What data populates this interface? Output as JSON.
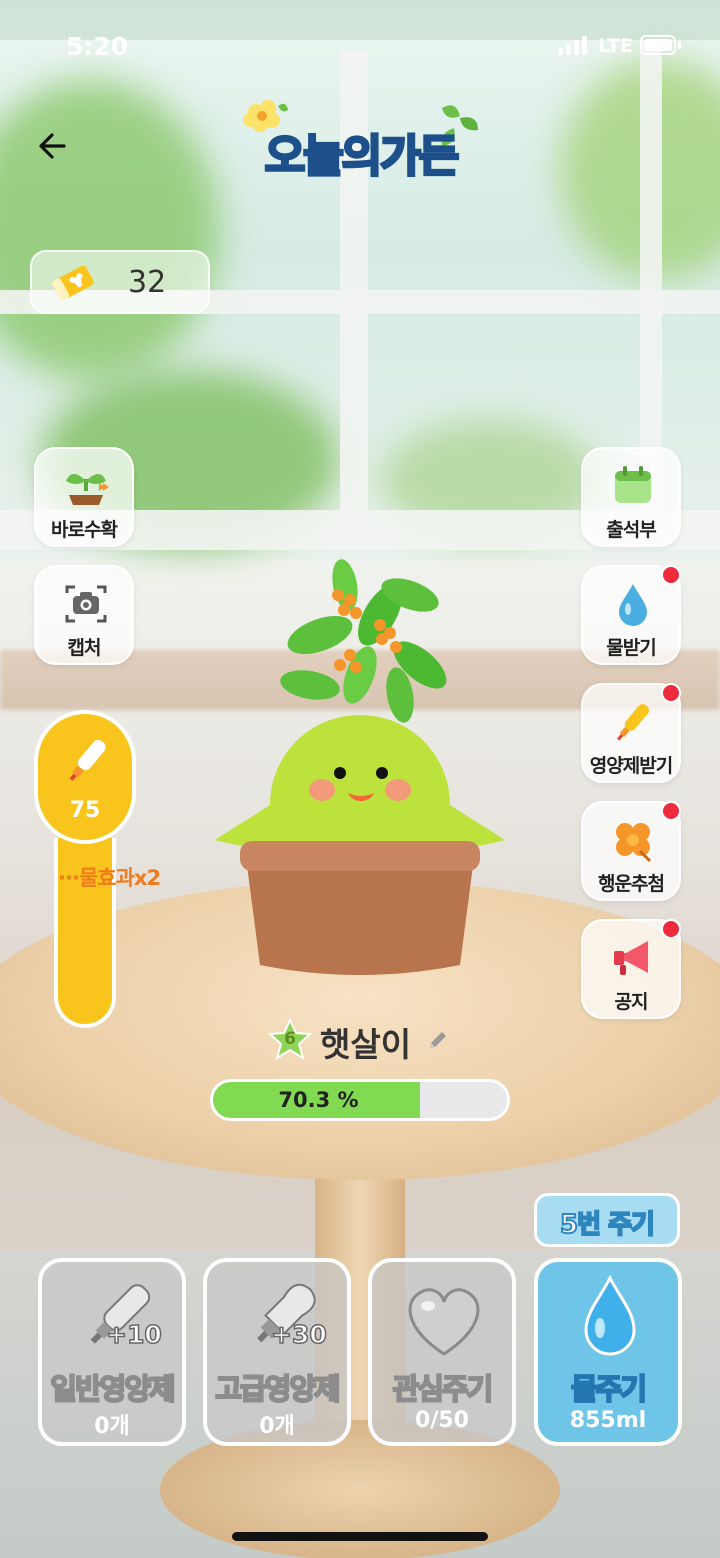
{
  "status_bar": {
    "time": "5:20",
    "network": "LTE"
  },
  "header": {
    "title": "오늘의가든"
  },
  "tickets": {
    "count": "32"
  },
  "left_buttons": [
    {
      "label": "바로수확",
      "icon": "sprout-icon"
    },
    {
      "label": "캡처",
      "icon": "camera-icon"
    }
  ],
  "right_buttons": [
    {
      "label": "출석부",
      "icon": "calendar-icon",
      "notification": false
    },
    {
      "label": "물받기",
      "icon": "water-drop-icon",
      "notification": true
    },
    {
      "label": "영양제받기",
      "icon": "nutrient-bottle-icon",
      "notification": true
    },
    {
      "label": "행운추첨",
      "icon": "clover-icon",
      "notification": true
    },
    {
      "label": "공지",
      "icon": "megaphone-icon",
      "notification": true
    }
  ],
  "nutrient_gauge": {
    "value": "75",
    "fill_fraction": 1.0,
    "effect_label": "물효과x2"
  },
  "plant": {
    "level": "6",
    "name": "햇살이",
    "progress_text": "70.3 %",
    "progress_fraction": 0.703
  },
  "water_count_badge": "5번 주기",
  "actions": [
    {
      "label": "일반영양제",
      "sub": "0개",
      "bonus": "+10",
      "icon": "nutrient-bottle-icon"
    },
    {
      "label": "고급영양제",
      "sub": "0개",
      "bonus": "+30",
      "icon": "premium-nutrient-icon"
    },
    {
      "label": "관심주기",
      "sub": "0/50",
      "icon": "heart-icon"
    },
    {
      "label": "물주기",
      "sub": "855ml",
      "icon": "water-drop-icon"
    }
  ],
  "colors": {
    "accent_yellow": "#f9c51c",
    "progress_green": "#82d952",
    "water_blue": "#6ec5e8",
    "notification_red": "#ee2b3c"
  }
}
